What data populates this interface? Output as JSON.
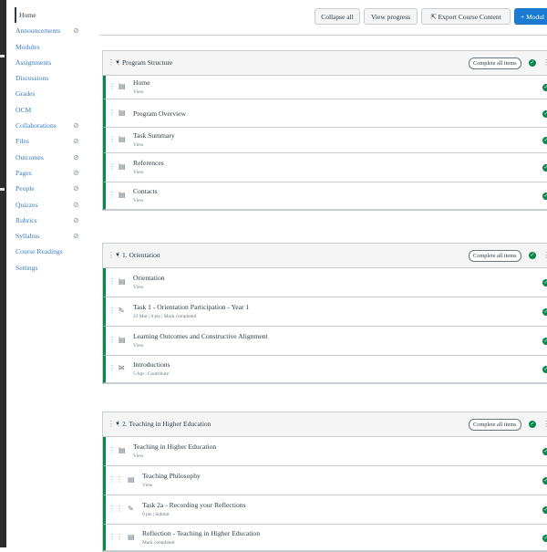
{
  "course_nav": [
    {
      "label": "Home",
      "eye": false,
      "active": true
    },
    {
      "label": "Announcements",
      "eye": true
    },
    {
      "label": "Modules",
      "eye": false
    },
    {
      "label": "Assignments",
      "eye": false
    },
    {
      "label": "Discussions",
      "eye": false
    },
    {
      "label": "Grades",
      "eye": false
    },
    {
      "label": "OCM",
      "eye": false
    },
    {
      "label": "Collaborations",
      "eye": true
    },
    {
      "label": "Files",
      "eye": true
    },
    {
      "label": "Outcomes",
      "eye": true
    },
    {
      "label": "Pages",
      "eye": true
    },
    {
      "label": "People",
      "eye": true
    },
    {
      "label": "Quizzes",
      "eye": true
    },
    {
      "label": "Rubrics",
      "eye": true
    },
    {
      "label": "Syllabus",
      "eye": true
    },
    {
      "label": "Course Readings",
      "eye": false
    },
    {
      "label": "Settings",
      "eye": false
    }
  ],
  "toolbar": {
    "collapse_all": "Collapse all",
    "view_progress": "View progress",
    "export": "Export Course Content",
    "add_module": "Modul"
  },
  "icons": {
    "drag": "drag-handle-icon",
    "eye": "eye-icon",
    "check": "complete-check-icon",
    "page": "page-icon",
    "assignment": "assignment-icon",
    "discussion": "discussion-icon"
  },
  "colors": {
    "accent": "#0b874b",
    "link": "#3b7bc0",
    "primary": "#1b7bd2"
  },
  "complete_all_label": "Complete all items",
  "modules": [
    {
      "title": "Program Structure",
      "items": [
        {
          "name": "Home",
          "meta": "View",
          "type": "page"
        },
        {
          "name": "Program Overview",
          "meta": "",
          "type": "page"
        },
        {
          "name": "Task Summary",
          "meta": "View",
          "type": "page"
        },
        {
          "name": "References",
          "meta": "View",
          "type": "page"
        },
        {
          "name": "Contacts",
          "meta": "View",
          "type": "page"
        }
      ]
    },
    {
      "title": "1. Orientation",
      "items": [
        {
          "name": "Orientation",
          "meta": "View",
          "type": "page"
        },
        {
          "name": "Task 1 - Orientation Participation - Year 1",
          "meta": "23 Mar  |  0 pts  |  Mark completed",
          "type": "assignment"
        },
        {
          "name": "Learning Outcomes and Constructive Alignment",
          "meta": "View",
          "type": "page"
        },
        {
          "name": "Introductions",
          "meta": "5 Apr  |  Contribute",
          "type": "discussion"
        }
      ]
    },
    {
      "title": "2. Teaching in Higher Education",
      "items": [
        {
          "name": "Teaching in Higher Education",
          "meta": "View",
          "type": "page"
        },
        {
          "name": "Teaching Philosophy",
          "meta": "View",
          "type": "page"
        },
        {
          "name": "Task 2a - Recording your Reflections",
          "meta": "0 pts  |  Submit",
          "type": "assignment"
        },
        {
          "name": "Reflection - Teaching in Higher Education",
          "meta": "Mark completed",
          "type": "page"
        }
      ]
    }
  ]
}
